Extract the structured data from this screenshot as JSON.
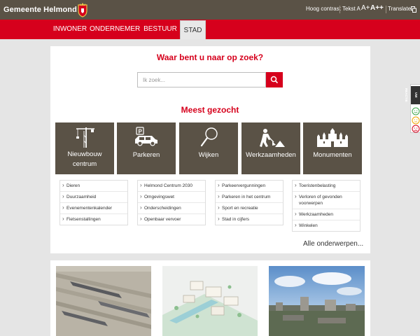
{
  "header": {
    "logo_text": "Gemeente Helmond",
    "utilities": {
      "contrast": "Hoog contrast",
      "text_size_label": "Tekst A",
      "text_plus": "A+",
      "text_plus_plus": "A++",
      "translate": "Translate"
    }
  },
  "nav": {
    "items": [
      "INWONER",
      "ONDERNEMER",
      "BESTUUR",
      "STAD"
    ],
    "active": "STAD"
  },
  "search": {
    "heading": "Waar bent u naar op zoek?",
    "placeholder": "Ik zoek..."
  },
  "popular": {
    "heading": "Meest gezocht",
    "tiles": [
      {
        "label": "Nieuwbouw centrum",
        "icon": "crane-icon"
      },
      {
        "label": "Parkeren",
        "icon": "parking-car-icon"
      },
      {
        "label": "Wijken",
        "icon": "magnifier-icon"
      },
      {
        "label": "Werkzaamheden",
        "icon": "roadworks-icon"
      },
      {
        "label": "Monumenten",
        "icon": "castle-icon"
      }
    ],
    "link_columns": [
      [
        "Dieren",
        "Duurzaamheid",
        "Evenementenkalender",
        "Fietsenstallingen"
      ],
      [
        "Helmond Centrum 2030",
        "Omgevingswet",
        "Onderscheidingen",
        "Openbaar vervoer"
      ],
      [
        "Parkeervergunningen",
        "Parkeren in het centrum",
        "Sport en recreatie",
        "Stad in cijfers"
      ],
      [
        "Toeristenbelasting",
        "Verloren of gevonden voorwerpen",
        "Werkzaamheden",
        "Winkelen"
      ]
    ],
    "all_topics": "Alle onderwerpen..."
  },
  "feedback": {
    "label": "UW REACTIE"
  },
  "colors": {
    "header_brown": "#5a5246",
    "brand_red": "#d6001c"
  }
}
